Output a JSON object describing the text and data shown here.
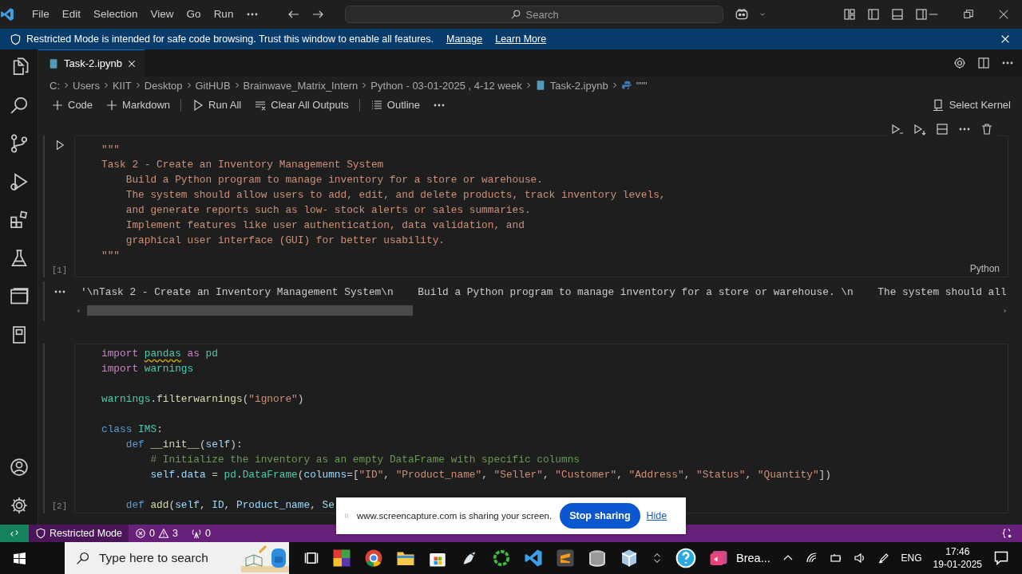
{
  "title_bar": {
    "menu": [
      "File",
      "Edit",
      "Selection",
      "View",
      "Go",
      "Run"
    ],
    "search_placeholder": "Search"
  },
  "banner": {
    "message": "Restricted Mode is intended for safe code browsing. Trust this window to enable all features.",
    "links": [
      "Manage",
      "Learn More"
    ]
  },
  "tabs": [
    {
      "label": "Task-2.ipynb",
      "selected": true
    }
  ],
  "breadcrumbs": [
    {
      "kind": "path",
      "label": "C:"
    },
    {
      "kind": "path",
      "label": "Users"
    },
    {
      "kind": "path",
      "label": "KIIT"
    },
    {
      "kind": "path",
      "label": "Desktop"
    },
    {
      "kind": "path",
      "label": "GitHUB"
    },
    {
      "kind": "path",
      "label": "Brainwave_Matrix_Intern"
    },
    {
      "kind": "path",
      "label": "Python - 03-01-2025 , 4-12 week"
    },
    {
      "kind": "notebook",
      "label": "Task-2.ipynb"
    },
    {
      "kind": "python",
      "label": "\"\"\""
    }
  ],
  "notebook_toolbar": {
    "actions": [
      {
        "kind": "add",
        "label": "Code"
      },
      {
        "kind": "add",
        "label": "Markdown"
      },
      {
        "kind": "run",
        "label": "Run All"
      },
      {
        "kind": "clear",
        "label": "Clear All Outputs"
      },
      {
        "kind": "outline",
        "label": "Outline"
      }
    ],
    "kernel": "Select Kernel"
  },
  "cells": [
    {
      "execution_count": "[1]",
      "language": "Python",
      "lines": [
        {
          "kind": "code",
          "tokens": [
            {
              "kind": "string",
              "text": "\"\"\""
            }
          ]
        },
        {
          "kind": "code",
          "tokens": [
            {
              "kind": "string",
              "text": "Task 2 - Create an Inventory Management System"
            }
          ]
        },
        {
          "kind": "code",
          "tokens": [
            {
              "kind": "string",
              "text": "    Build a Python program to manage inventory for a store or warehouse."
            }
          ]
        },
        {
          "kind": "code",
          "tokens": [
            {
              "kind": "string",
              "text": "    The system should allow users to add, edit, and delete products, track inventory levels,"
            }
          ]
        },
        {
          "kind": "code",
          "tokens": [
            {
              "kind": "string",
              "text": "    and generate reports such as low- stock alerts or sales summaries."
            }
          ]
        },
        {
          "kind": "code",
          "tokens": [
            {
              "kind": "string",
              "text": "    Implement features like user authentication, data validation, and"
            }
          ]
        },
        {
          "kind": "code",
          "tokens": [
            {
              "kind": "string",
              "text": "    graphical user interface (GUI) for better usability."
            }
          ]
        },
        {
          "kind": "code",
          "tokens": [
            {
              "kind": "string",
              "text": "\"\"\""
            }
          ]
        }
      ],
      "output": "'\\nTask 2 - Create an Inventory Management System\\n    Build a Python program to manage inventory for a store or warehouse. \\n    The system should all"
    },
    {
      "execution_count": "[2]",
      "lines": [
        {
          "kind": "code",
          "tokens": [
            {
              "kind": "control",
              "text": "import "
            },
            {
              "kind": "module",
              "text": "pandas",
              "warning": true
            },
            {
              "kind": "control",
              "text": " as "
            },
            {
              "kind": "module",
              "text": "pd"
            }
          ]
        },
        {
          "kind": "code",
          "tokens": [
            {
              "kind": "control",
              "text": "import "
            },
            {
              "kind": "module",
              "text": "warnings"
            }
          ]
        },
        {
          "kind": "blank"
        },
        {
          "kind": "code",
          "tokens": [
            {
              "kind": "module",
              "text": "warnings"
            },
            {
              "kind": "plain",
              "text": "."
            },
            {
              "kind": "function",
              "text": "filterwarnings"
            },
            {
              "kind": "plain",
              "text": "("
            },
            {
              "kind": "string",
              "text": "\"ignore\""
            },
            {
              "kind": "plain",
              "text": ")"
            }
          ]
        },
        {
          "kind": "blank"
        },
        {
          "kind": "code",
          "tokens": [
            {
              "kind": "keyword",
              "text": "class "
            },
            {
              "kind": "module",
              "text": "IMS"
            },
            {
              "kind": "plain",
              "text": ":"
            }
          ]
        },
        {
          "kind": "code",
          "tokens": [
            {
              "kind": "keyword",
              "text": "    def "
            },
            {
              "kind": "function",
              "text": "__init__"
            },
            {
              "kind": "plain",
              "text": "("
            },
            {
              "kind": "variable",
              "text": "self"
            },
            {
              "kind": "plain",
              "text": "):"
            }
          ]
        },
        {
          "kind": "code",
          "tokens": [
            {
              "kind": "comment",
              "text": "        # Initialize the inventory as an empty DataFrame with specific columns"
            }
          ]
        },
        {
          "kind": "code",
          "tokens": [
            {
              "kind": "variable",
              "text": "        self"
            },
            {
              "kind": "plain",
              "text": "."
            },
            {
              "kind": "variable",
              "text": "data"
            },
            {
              "kind": "plain",
              "text": " = "
            },
            {
              "kind": "module",
              "text": "pd"
            },
            {
              "kind": "plain",
              "text": "."
            },
            {
              "kind": "module",
              "text": "DataFrame"
            },
            {
              "kind": "plain",
              "text": "("
            },
            {
              "kind": "variable",
              "text": "columns"
            },
            {
              "kind": "plain",
              "text": "=["
            },
            {
              "kind": "string",
              "text": "\"ID\""
            },
            {
              "kind": "plain",
              "text": ", "
            },
            {
              "kind": "string",
              "text": "\"Product_name\""
            },
            {
              "kind": "plain",
              "text": ", "
            },
            {
              "kind": "string",
              "text": "\"Seller\""
            },
            {
              "kind": "plain",
              "text": ", "
            },
            {
              "kind": "string",
              "text": "\"Customer\""
            },
            {
              "kind": "plain",
              "text": ", "
            },
            {
              "kind": "string",
              "text": "\"Address\""
            },
            {
              "kind": "plain",
              "text": ", "
            },
            {
              "kind": "string",
              "text": "\"Status\""
            },
            {
              "kind": "plain",
              "text": ", "
            },
            {
              "kind": "string",
              "text": "\"Quantity\""
            },
            {
              "kind": "plain",
              "text": "])"
            }
          ]
        },
        {
          "kind": "blank"
        },
        {
          "kind": "code",
          "tokens": [
            {
              "kind": "keyword",
              "text": "    def "
            },
            {
              "kind": "function",
              "text": "add"
            },
            {
              "kind": "plain",
              "text": "("
            },
            {
              "kind": "variable",
              "text": "self"
            },
            {
              "kind": "plain",
              "text": ", "
            },
            {
              "kind": "variable",
              "text": "ID"
            },
            {
              "kind": "plain",
              "text": ", "
            },
            {
              "kind": "variable",
              "text": "Product_name"
            },
            {
              "kind": "plain",
              "text": ", "
            },
            {
              "kind": "variable",
              "text": "Se"
            }
          ]
        }
      ]
    }
  ],
  "sharing_bar": {
    "message": "www.screencapture.com is sharing your screen.",
    "stop": "Stop sharing",
    "hide": "Hide"
  },
  "status_bar": {
    "mode": "Restricted Mode",
    "errors": "0",
    "warnings": "3",
    "ports": "0"
  },
  "taskbar": {
    "search_placeholder": "Type here to search",
    "app_label": "Brea...",
    "language": "ENG",
    "time": "17:46",
    "date": "19-01-2025"
  }
}
